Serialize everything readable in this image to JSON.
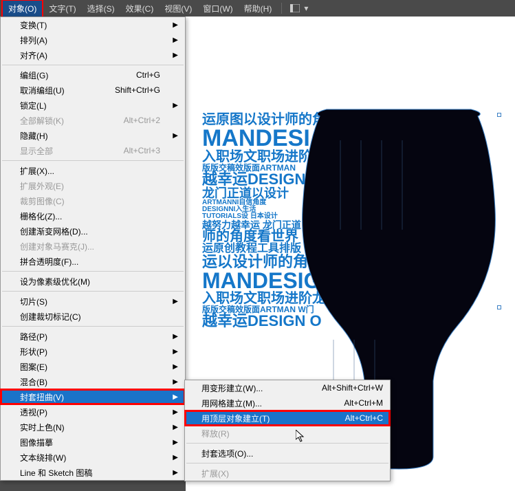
{
  "menubar": {
    "items": [
      "对象(O)",
      "文字(T)",
      "选择(S)",
      "效果(C)",
      "视图(V)",
      "窗口(W)",
      "帮助(H)"
    ],
    "active_index": 0
  },
  "dropdown": {
    "groups": [
      [
        {
          "label": "变换(T)",
          "arrow": true
        },
        {
          "label": "排列(A)",
          "arrow": true
        },
        {
          "label": "对齐(A)",
          "arrow": true
        }
      ],
      [
        {
          "label": "编组(G)",
          "shortcut": "Ctrl+G"
        },
        {
          "label": "取消编组(U)",
          "shortcut": "Shift+Ctrl+G"
        },
        {
          "label": "锁定(L)",
          "arrow": true
        },
        {
          "label": "全部解锁(K)",
          "shortcut": "Alt+Ctrl+2",
          "disabled": true
        },
        {
          "label": "隐藏(H)",
          "arrow": true
        },
        {
          "label": "显示全部",
          "shortcut": "Alt+Ctrl+3",
          "disabled": true
        }
      ],
      [
        {
          "label": "扩展(X)..."
        },
        {
          "label": "扩展外观(E)",
          "disabled": true
        },
        {
          "label": "裁剪图像(C)",
          "disabled": true
        },
        {
          "label": "栅格化(Z)..."
        },
        {
          "label": "创建渐变网格(D)..."
        },
        {
          "label": "创建对象马赛克(J)...",
          "disabled": true
        },
        {
          "label": "拼合透明度(F)..."
        }
      ],
      [
        {
          "label": "设为像素级优化(M)"
        }
      ],
      [
        {
          "label": "切片(S)",
          "arrow": true
        },
        {
          "label": "创建裁切标记(C)"
        }
      ],
      [
        {
          "label": "路径(P)",
          "arrow": true
        },
        {
          "label": "形状(P)",
          "arrow": true
        },
        {
          "label": "图案(E)",
          "arrow": true
        },
        {
          "label": "混合(B)",
          "arrow": true
        },
        {
          "label": "封套扭曲(V)",
          "arrow": true,
          "highlighted": true,
          "boxed": true
        },
        {
          "label": "透视(P)",
          "arrow": true
        },
        {
          "label": "实时上色(N)",
          "arrow": true
        },
        {
          "label": "图像描摹",
          "arrow": true
        },
        {
          "label": "文本绕排(W)",
          "arrow": true
        },
        {
          "label": "Line 和 Sketch 图稿",
          "arrow": true
        }
      ]
    ]
  },
  "submenu": {
    "items": [
      {
        "label": "用变形建立(W)...",
        "shortcut": "Alt+Shift+Ctrl+W"
      },
      {
        "label": "用网格建立(M)...",
        "shortcut": "Alt+Ctrl+M"
      },
      {
        "label": "用顶层对象建立(T)",
        "shortcut": "Alt+Ctrl+C",
        "highlighted": true,
        "boxed": true
      },
      {
        "label": "释放(R)",
        "disabled": true
      },
      {
        "sep": true
      },
      {
        "label": "封套选项(O)..."
      },
      {
        "sep": true
      },
      {
        "label": "扩展(X)",
        "disabled": true
      }
    ]
  },
  "art_text": {
    "lines": [
      {
        "t": "运原图以设计师的角",
        "s": 20
      },
      {
        "t": "MANDESI",
        "s": 34
      },
      {
        "t": "入职场文职场进阶",
        "s": 20
      },
      {
        "t": "版版交稿效版面ARTMAN",
        "s": 12
      },
      {
        "t": "越幸运DESIGN",
        "s": 22
      },
      {
        "t": "龙门正道以设计",
        "s": 18
      },
      {
        "t": "ARTMANNI自信角度",
        "s": 10
      },
      {
        "t": "DESIGNNI入生活",
        "s": 10
      },
      {
        "t": "TUTORIALS设 日本设计",
        "s": 10
      },
      {
        "t": "越努力越幸运 龙门正道",
        "s": 14
      },
      {
        "t": "师的角度看世界",
        "s": 20
      },
      {
        "t": "运原创教程工具排版",
        "s": 16
      },
      {
        "t": "运以设计师的角",
        "s": 22
      },
      {
        "t": "MANDESIGN",
        "s": 32
      },
      {
        "t": "入职场文职场进阶龙",
        "s": 20
      },
      {
        "t": "版版交稿效版面ARTMAN W门",
        "s": 12
      },
      {
        "t": "越幸运DESIGN O",
        "s": 22
      }
    ]
  }
}
